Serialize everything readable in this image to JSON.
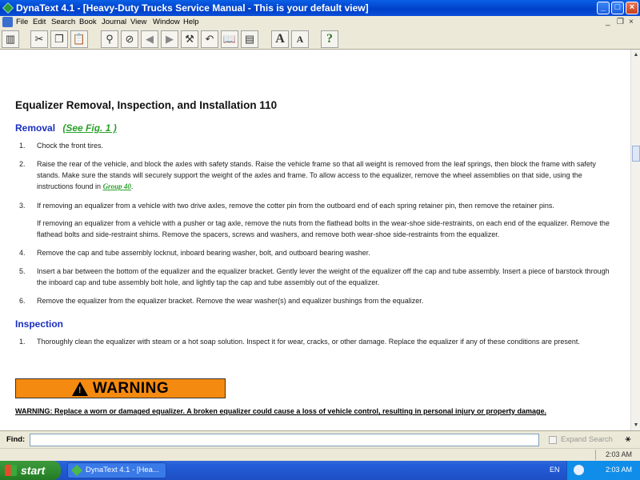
{
  "window": {
    "title": "DynaText 4.1 - [Heavy-Duty Trucks Service Manual - This is your default view]",
    "controls": {
      "minimize": "_",
      "maximize": "□",
      "close": "×"
    }
  },
  "menu": {
    "items": [
      "File",
      "Edit",
      "Search",
      "Book",
      "Journal",
      "View",
      "Window",
      "Help"
    ],
    "mdi": {
      "minimize": "_",
      "restore": "❐",
      "close": "×"
    }
  },
  "toolbar": {
    "font_increase": "A",
    "font_decrease": "A",
    "help": "?"
  },
  "document": {
    "title": "Equalizer Removal, Inspection, and Installation  110",
    "removal": {
      "heading": "Removal",
      "fig_link": "(See Fig. 1 )",
      "steps": [
        {
          "num": "1.",
          "text": "Chock the front tires."
        },
        {
          "num": "2.",
          "text": "Raise the rear of the vehicle, and block the axles with safety stands. Raise the vehicle frame so that all weight is removed from the leaf springs, then block the frame with safety stands. Make sure the stands will securely support the weight of the axles and frame. To allow access to the equalizer, remove the wheel assemblies on that side, using the instructions found in",
          "link": "Group 40",
          "tail": "."
        },
        {
          "num": "3.",
          "text": "If removing an equalizer from a vehicle with two drive axles, remove the cotter pin from the outboard end of each spring retainer pin, then remove the retainer pins."
        },
        {
          "num": "",
          "text": "If removing an equalizer from a vehicle with a pusher or tag axle, remove the nuts from the flathead bolts in the wear-shoe side-restraints, on each end of the equalizer. Remove the flathead bolts and side-restraint shims. Remove the spacers, screws and washers, and remove both wear-shoe side-restraints from the equalizer."
        },
        {
          "num": "4.",
          "text": "Remove the cap and tube assembly locknut, inboard bearing washer, bolt, and outboard bearing washer."
        },
        {
          "num": "5.",
          "text": "Insert a bar between the bottom of the equalizer and the equalizer bracket. Gently lever the weight of the equalizer off the cap and tube assembly. Insert a piece of barstock through the inboard cap and tube assembly bolt hole, and lightly tap the cap and tube assembly out of the equalizer."
        },
        {
          "num": "6.",
          "text": "Remove the equalizer from the equalizer bracket. Remove the wear washer(s) and equalizer bushings from the equalizer."
        }
      ]
    },
    "inspection": {
      "heading": "Inspection",
      "steps": [
        {
          "num": "1.",
          "text": "Thoroughly clean the equalizer with steam or a hot soap solution. Inspect it for wear, cracks, or other damage. Replace the equalizer if any of these conditions are present."
        }
      ]
    },
    "warning": {
      "badge": "WARNING",
      "symbol": "!",
      "text": "WARNING: Replace a worn or damaged equalizer. A broken equalizer could cause a loss of vehicle control, resulting in personal injury or property damage."
    }
  },
  "findbar": {
    "label": "Find:",
    "value": "",
    "expand_label": "Expand Search"
  },
  "statusbar": {
    "time": "2:03 AM"
  },
  "taskbar": {
    "start": "start",
    "task": "DynaText 4.1 - [Hea...",
    "lang": "EN",
    "time": "2:03 AM"
  },
  "colors": {
    "heading_blue": "#1a2fbf",
    "link_green": "#2aa02a",
    "warning_orange": "#f58a10"
  }
}
